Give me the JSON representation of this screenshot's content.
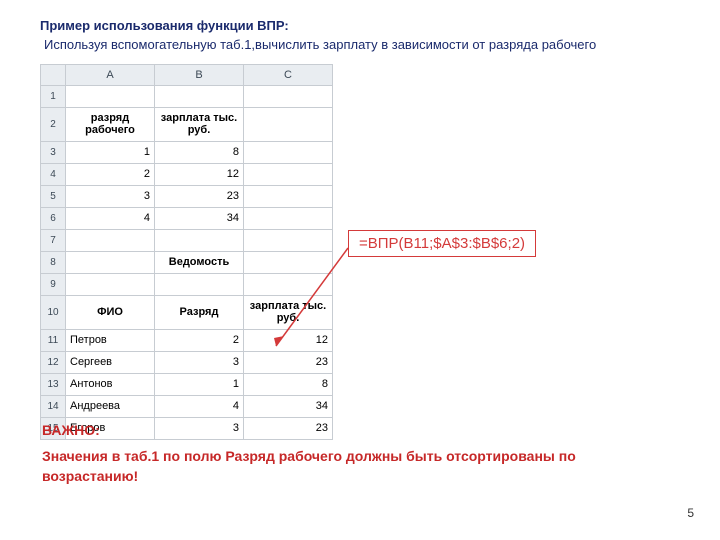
{
  "title": "Пример использования функции ВПР:",
  "subtitle": "Используя вспомогательную таб.1,вычислить зарплату в зависимости от разряда рабочего",
  "cols": {
    "a": "A",
    "b": "B",
    "c": "C"
  },
  "rows": {
    "r1": "1",
    "r2": "2",
    "r3": "3",
    "r4": "4",
    "r5": "5",
    "r6": "6",
    "r7": "7",
    "r8": "8",
    "r9": "9",
    "r10": "10",
    "r11": "11",
    "r12": "12",
    "r13": "13",
    "r14": "14",
    "r15": "15"
  },
  "hdr": {
    "rank": "разряд рабочего",
    "salary": "зарплата тыс. руб."
  },
  "t1": [
    {
      "rank": 1,
      "salary": 8
    },
    {
      "rank": 2,
      "salary": 12
    },
    {
      "rank": 3,
      "salary": 23
    },
    {
      "rank": 4,
      "salary": 34
    }
  ],
  "sheetTitle": "Ведомость",
  "hdr2": {
    "fio": "ФИО",
    "rank": "Разряд",
    "salary": "зарплата тыс. руб."
  },
  "t2": [
    {
      "fio": "Петров",
      "rank": 2,
      "salary": 12
    },
    {
      "fio": "Сергеев",
      "rank": 3,
      "salary": 23
    },
    {
      "fio": "Антонов",
      "rank": 1,
      "salary": 8
    },
    {
      "fio": "Андреева",
      "rank": 4,
      "salary": 34
    },
    {
      "fio": "Егоров",
      "rank": 3,
      "salary": 23
    }
  ],
  "formula": "=ВПР(B11;$A$3:$B$6;2)",
  "important_label": "ВАЖНО:",
  "important_text": "Значения в таб.1 по полю Разряд рабочего должны быть отсортированы по   возрастанию!",
  "page": "5"
}
